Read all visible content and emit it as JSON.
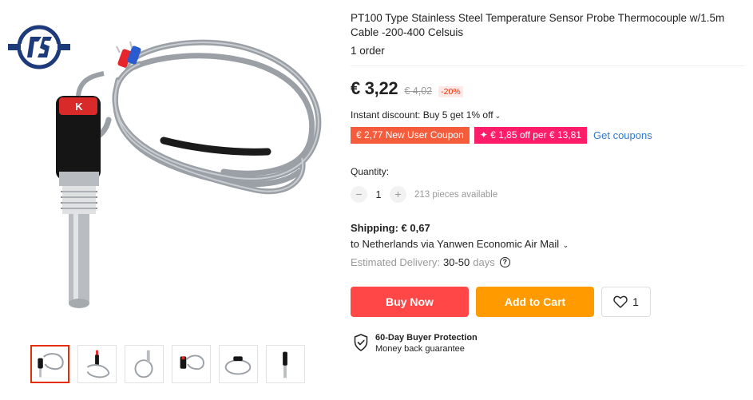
{
  "product": {
    "title": "PT100 Type Stainless Steel Temperature Sensor Probe Thermocouple w/1.5m Cable -200-400 Celsuis",
    "orders": "1 order",
    "image_label": "K"
  },
  "price": {
    "current": "€ 3,22",
    "original": "€ 4,02",
    "discount": "-20%"
  },
  "instant_discount": {
    "label": "Instant discount: Buy 5 get 1% off",
    "caret_icon": "chevron-down-icon"
  },
  "coupons": {
    "new_user": "€ 2,77 New User Coupon",
    "store": "✦ € 1,85 off per € 13,81",
    "get_label": "Get coupons",
    "colors": {
      "red": "#f45c3c",
      "pink": "#ff1d6a",
      "link": "#2e7bd1"
    }
  },
  "quantity": {
    "label": "Quantity:",
    "minus": "−",
    "value": "1",
    "plus": "+",
    "available": "213 pieces available"
  },
  "shipping": {
    "cost": "Shipping: € 0,67",
    "route": "to Netherlands via Yanwen Economic Air Mail",
    "estimated_label": "Estimated Delivery:",
    "estimated_value": "30-50",
    "estimated_unit": "days",
    "help_glyph": "?"
  },
  "actions": {
    "buy_now": "Buy Now",
    "add_to_cart": "Add to Cart",
    "wishlist_count": "1",
    "colors": {
      "buy": "#ff4747",
      "cart": "#ff9a00"
    }
  },
  "protection": {
    "title": "60-Day Buyer Protection",
    "subtitle": "Money back guarantee"
  },
  "gallery": {
    "thumbnail_count": 6,
    "selected_index": 0,
    "selected_border": "#e62e04"
  }
}
